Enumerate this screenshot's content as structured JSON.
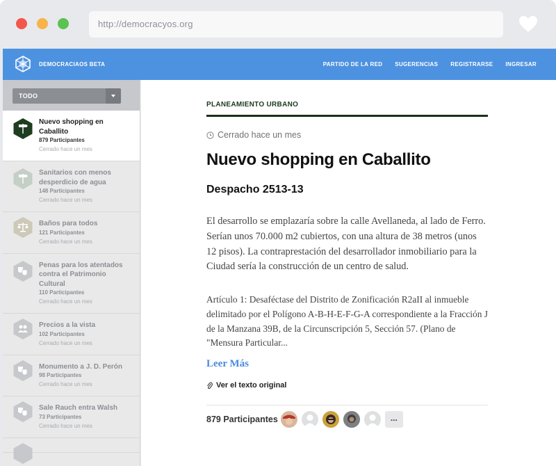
{
  "browser": {
    "url": "http://democracyos.org"
  },
  "header": {
    "brand": "DEMOCRACIAOS BETA",
    "nav": [
      "PARTIDO DE LA RED",
      "SUGERENCIAS",
      "REGISTRARSE",
      "INGRESAR"
    ]
  },
  "sidebar": {
    "filter_label": "TODO",
    "items": [
      {
        "title": "Nuevo shopping en Caballito",
        "count": "879 Participantes",
        "status": "Cerrado hace un mes",
        "icon": "signpost-icon"
      },
      {
        "title": "Sanitarios con menos desperdicio de agua",
        "count": "148 Participantes",
        "status": "Cerrado hace un mes",
        "icon": "signpost-icon"
      },
      {
        "title": "Baños para todos",
        "count": "121 Participantes",
        "status": "Cerrado hace un mes",
        "icon": "scales-icon"
      },
      {
        "title": "Penas para los atentados contra el Patrimonio Cultural",
        "count": "110 Participantes",
        "status": "Cerrado hace un mes",
        "icon": "theater-masks-icon"
      },
      {
        "title": "Precios a la vista",
        "count": "102 Participantes",
        "status": "Cerrado hace un mes",
        "icon": "people-icon"
      },
      {
        "title": "Monumento a J. D. Perón",
        "count": "98 Participantes",
        "status": "Cerrado hace un mes",
        "icon": "theater-masks-icon"
      },
      {
        "title": "Sale Rauch entra Walsh",
        "count": "73 Participantes",
        "status": "Cerrado hace un mes",
        "icon": "theater-masks-icon"
      }
    ]
  },
  "main": {
    "category": "PLANEAMIENTO URBANO",
    "closed": "Cerrado hace un mes",
    "title": "Nuevo shopping en Caballito",
    "subtitle": "Despacho 2513-13",
    "summary": "El desarrollo se emplazaría sobre la calle Avellaneda, al lado de Ferro. Serían unos 70.000 m2 cubiertos, con una altura de 38 metros (unos 12 pisos). La contraprestación del desarrollador inmobiliario para la Ciudad sería la construcción de un centro de salud.",
    "article": "Artículo 1: Desaféctase del Distrito de Zonificación R2aII al inmueble delimitado por el Polígono A-B-H-E-F-G-A correspondiente a la Fracción J de la Manzana 39B, de la Circunscripción 5, Sección 57. (Plano de \"Mensura Particular...",
    "read_more": "Leer Más",
    "original": "Ver el texto original",
    "participants": "879 Participantes",
    "more": "..."
  },
  "colors": {
    "accent": "#4d92e0",
    "category": "#193017",
    "active_icon": "#1f3d1f"
  }
}
